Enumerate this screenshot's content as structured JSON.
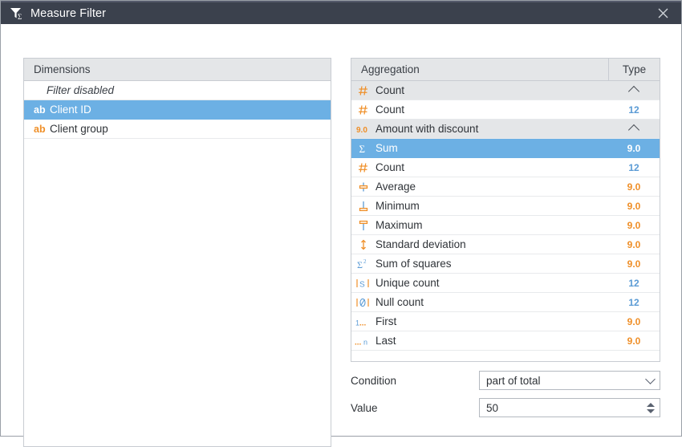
{
  "window": {
    "title": "Measure Filter",
    "title_icon": "filter-sigma-icon",
    "close_icon": "close-icon",
    "titlebar_color": "#3b414d",
    "accent_color": "#6cb0e4",
    "icon_orange": "#ef8f28",
    "number_blue": "#5b9bd5"
  },
  "dimensions_panel": {
    "header": "Dimensions",
    "rows": [
      {
        "label": "Filter disabled",
        "icon": "",
        "selected": false,
        "italic": true
      },
      {
        "label": "Client ID",
        "icon": "ab",
        "selected": true,
        "italic": false
      },
      {
        "label": "Client group",
        "icon": "ab",
        "selected": false,
        "italic": false
      }
    ]
  },
  "aggregation_panel": {
    "header_name": "Aggregation",
    "header_type": "Type",
    "rows": [
      {
        "label": "Count",
        "icon": "hash-icon",
        "type": "",
        "type_kind": "chevron",
        "group": true,
        "selected": false
      },
      {
        "label": "Count",
        "icon": "hash-icon",
        "type": "12",
        "type_kind": "int",
        "group": false,
        "selected": false
      },
      {
        "label": "Amount with discount",
        "icon": "decimal-icon",
        "type": "",
        "type_kind": "chevron",
        "group": true,
        "selected": false
      },
      {
        "label": "Sum",
        "icon": "sigma-icon",
        "type": "9.0",
        "type_kind": "dec",
        "group": false,
        "selected": true
      },
      {
        "label": "Count",
        "icon": "hash-icon",
        "type": "12",
        "type_kind": "int",
        "group": false,
        "selected": false
      },
      {
        "label": "Average",
        "icon": "average-icon",
        "type": "9.0",
        "type_kind": "dec",
        "group": false,
        "selected": false
      },
      {
        "label": "Minimum",
        "icon": "minimum-icon",
        "type": "9.0",
        "type_kind": "dec",
        "group": false,
        "selected": false
      },
      {
        "label": "Maximum",
        "icon": "maximum-icon",
        "type": "9.0",
        "type_kind": "dec",
        "group": false,
        "selected": false
      },
      {
        "label": "Standard deviation",
        "icon": "stddev-icon",
        "type": "9.0",
        "type_kind": "dec",
        "group": false,
        "selected": false
      },
      {
        "label": "Sum of squares",
        "icon": "sigma-squared-icon",
        "type": "9.0",
        "type_kind": "dec",
        "group": false,
        "selected": false
      },
      {
        "label": "Unique count",
        "icon": "unique-count-icon",
        "type": "12",
        "type_kind": "int",
        "group": false,
        "selected": false
      },
      {
        "label": "Null count",
        "icon": "null-count-icon",
        "type": "12",
        "type_kind": "int",
        "group": false,
        "selected": false
      },
      {
        "label": "First",
        "icon": "first-icon",
        "type": "9.0",
        "type_kind": "dec",
        "group": false,
        "selected": false
      },
      {
        "label": "Last",
        "icon": "last-icon",
        "type": "9.0",
        "type_kind": "dec",
        "group": false,
        "selected": false
      }
    ]
  },
  "form": {
    "condition_label": "Condition",
    "condition_value": "part of total",
    "condition_icon": "chevron-down-icon",
    "value_label": "Value",
    "value_value": "50",
    "value_icon": "spinner-icon"
  }
}
